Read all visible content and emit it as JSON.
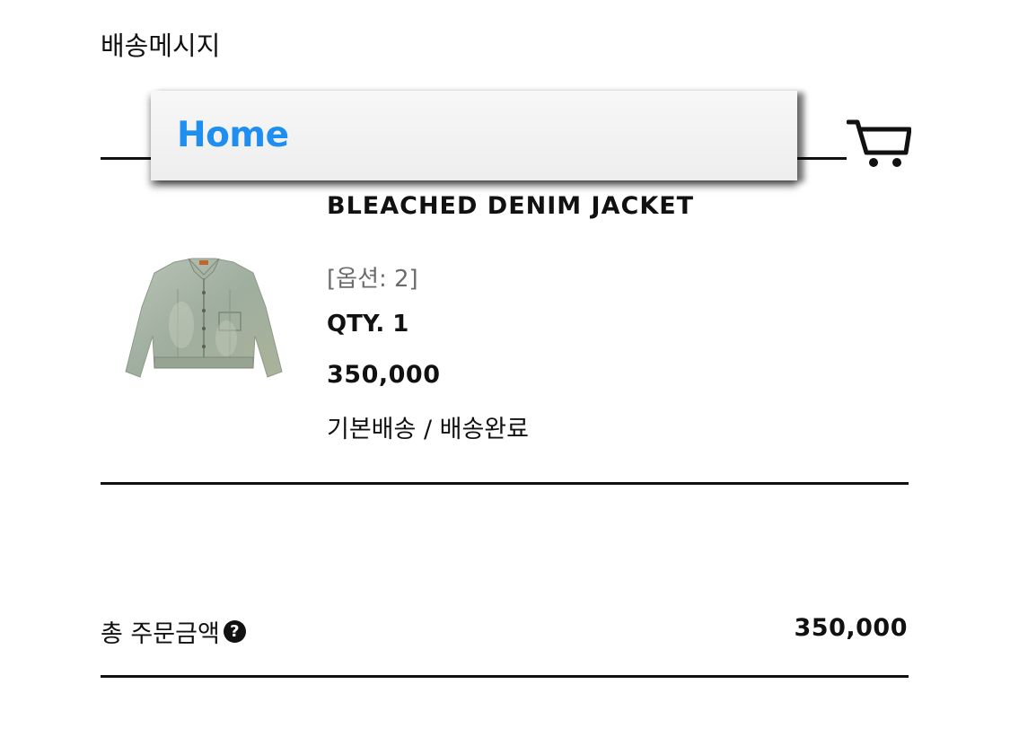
{
  "header": {
    "shipping_message_label": "배송메시지"
  },
  "popup": {
    "home_label": "Home"
  },
  "cart": {
    "icon": "cart-icon"
  },
  "product": {
    "name": "BLEACHED DENIM JACKET",
    "option": "[옵션: 2]",
    "qty": "QTY. 1",
    "price": "350,000",
    "delivery": "기본배송 / 배송완료",
    "image_icon": "denim-jacket-image"
  },
  "summary": {
    "total_label": "총 주문금액",
    "help_icon_text": "?",
    "total_value": "350,000"
  },
  "colors": {
    "home_link": "#1f8ef1",
    "text": "#111111",
    "option_text": "#6c6c6c"
  }
}
